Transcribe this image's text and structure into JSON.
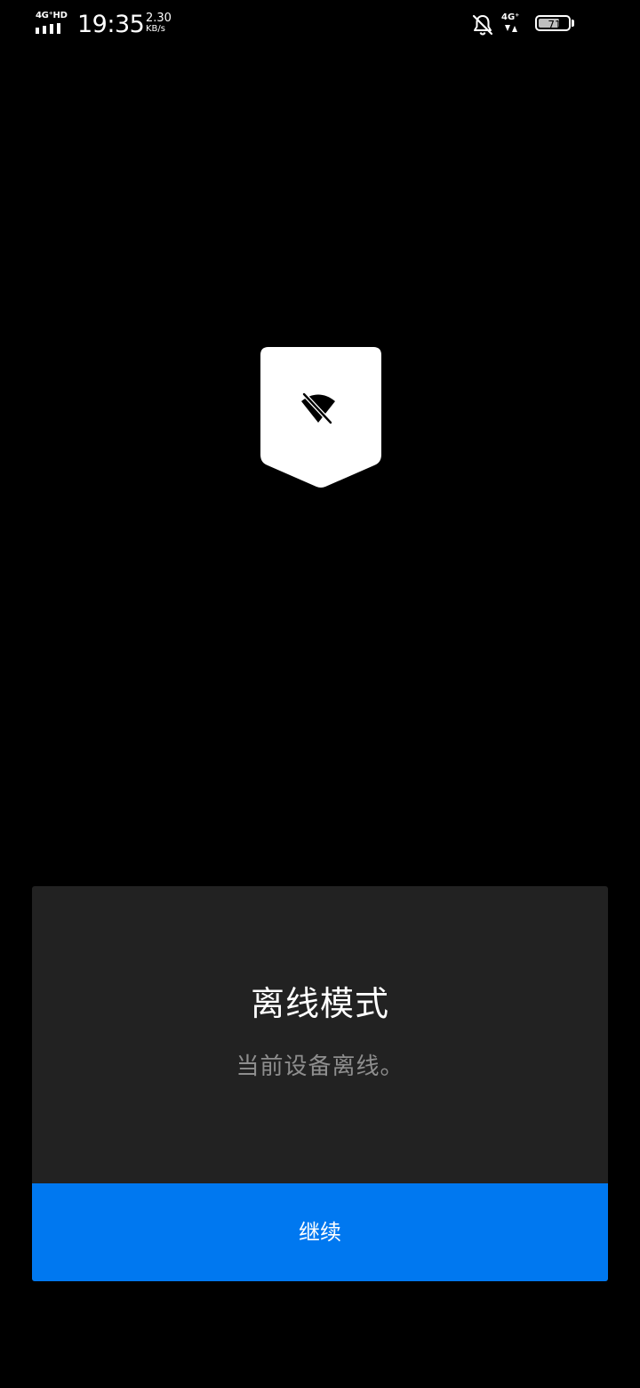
{
  "status_bar": {
    "left_network_label": "4G⁺HD",
    "time": "19:35",
    "net_speed_value": "2.30",
    "net_speed_unit": "KB/s",
    "right_network_label": "4G⁺",
    "battery_level": "71",
    "battery_fraction": 0.71,
    "icons": [
      "signal-bars-icon",
      "bell-muted-icon",
      "data-arrows-icon",
      "battery-icon"
    ]
  },
  "badge": {
    "icon": "wifi-off-icon",
    "colors": {
      "badge": "#ffffff",
      "glyph": "#000000"
    }
  },
  "dialog": {
    "title": "离线模式",
    "message": "当前设备离线。",
    "continue_label": "继续",
    "colors": {
      "background": "#222222",
      "title": "#ffffff",
      "message": "#8e8e8e",
      "button": "#0078f0",
      "button_text": "#ffffff"
    }
  },
  "screen_background": "#000000"
}
